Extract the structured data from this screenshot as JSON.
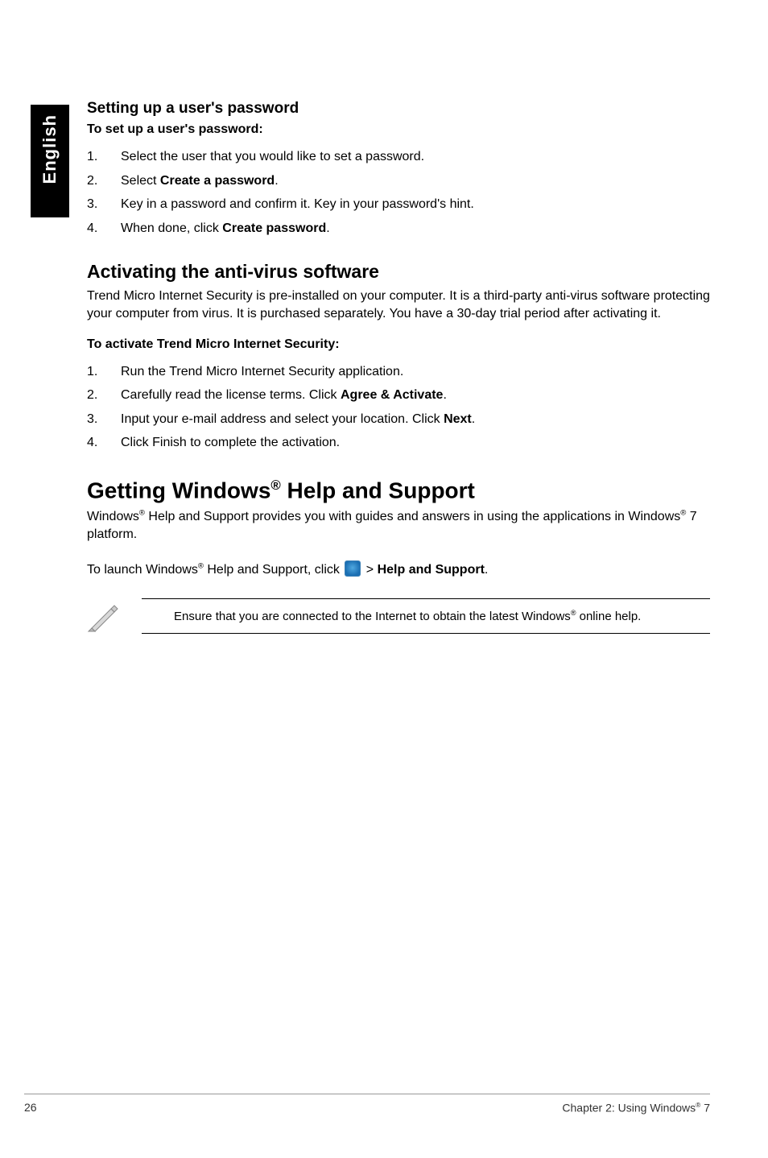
{
  "side_tab": "English",
  "section1": {
    "heading": "Setting up a user's password",
    "intro": "To set up a user's password:",
    "steps": [
      {
        "n": "1.",
        "pre": "Select the user that you would like to set a password."
      },
      {
        "n": "2.",
        "pre": "Select ",
        "bold": "Create a password",
        "post": "."
      },
      {
        "n": "3.",
        "pre": "Key in a password and confirm it. Key in your password's hint."
      },
      {
        "n": "4.",
        "pre": "When done, click ",
        "bold": "Create password",
        "post": "."
      }
    ]
  },
  "section2": {
    "heading": "Activating the anti-virus software",
    "body": "Trend Micro Internet Security is pre-installed on your computer. It is a third-party anti-virus software protecting your computer from virus. It is purchased separately. You have a 30-day trial period after activating it.",
    "intro": "To activate Trend Micro Internet Security:",
    "steps": [
      {
        "n": "1.",
        "pre": "Run the Trend Micro Internet Security application."
      },
      {
        "n": "2.",
        "pre": "Carefully read the license terms. Click ",
        "bold": "Agree & Activate",
        "post": "."
      },
      {
        "n": "3.",
        "pre": "Input your e-mail address and select your location. Click ",
        "bold": "Next",
        "post": "."
      },
      {
        "n": "4.",
        "pre": "Click Finish to complete the activation."
      }
    ]
  },
  "section3": {
    "heading_pre": "Getting Windows",
    "heading_sup": "®",
    "heading_post": " Help and Support",
    "body_parts": {
      "p1a": "Windows",
      "p1b": " Help and Support provides you with guides and answers in using the applications in Windows",
      "p1c": " 7 platform.",
      "p2a": "To launch Windows",
      "p2b": " Help and Support, click ",
      "p2c": " > ",
      "p2bold": "Help and Support",
      "p2d": "."
    },
    "note_pre": "Ensure that you are connected to the Internet to obtain the latest Windows",
    "note_post": " online help."
  },
  "footer": {
    "page": "26",
    "chapter_pre": "Chapter 2: Using Windows",
    "chapter_sup": "®",
    "chapter_post": " 7"
  },
  "reg": "®"
}
